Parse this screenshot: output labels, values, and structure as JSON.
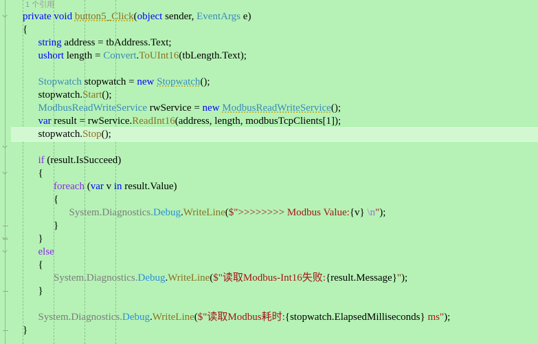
{
  "editor": {
    "language": "csharp",
    "background_color": "#b6f2b6",
    "current_line_color": "#d2f8d2",
    "current_line_index": 9,
    "font_size_px": 15,
    "line_height_px": 19,
    "colors": {
      "keyword": "#0000ff",
      "control_keyword": "#8a2be2",
      "type": "#3b8bb5",
      "method": "#8b7020",
      "string": "#a31515",
      "escape": "#9d74d0",
      "namespace": "#7c7c7c",
      "class_static": "#2e8fd4",
      "plain": "#000000",
      "indent_guide": "#8fbf8f",
      "fold_margin": "#9ab89a"
    }
  },
  "codelens": {
    "text": "1 个引用"
  },
  "code": {
    "lines": [
      {
        "indent": 0,
        "tokens": [
          {
            "t": "private",
            "c": "kw"
          },
          {
            "t": " ",
            "c": "pln"
          },
          {
            "t": "void",
            "c": "kw"
          },
          {
            "t": " ",
            "c": "pln"
          },
          {
            "t": "button5_Click",
            "c": "mth squig"
          },
          {
            "t": "(",
            "c": "pln"
          },
          {
            "t": "object",
            "c": "kw"
          },
          {
            "t": " sender, ",
            "c": "pln"
          },
          {
            "t": "EventArgs",
            "c": "typ"
          },
          {
            "t": " e)",
            "c": "pln"
          }
        ]
      },
      {
        "indent": 0,
        "tokens": [
          {
            "t": "{",
            "c": "pln"
          }
        ]
      },
      {
        "indent": 1,
        "tokens": [
          {
            "t": "string",
            "c": "kw"
          },
          {
            "t": " address = tbAddress.Text;",
            "c": "pln"
          }
        ]
      },
      {
        "indent": 1,
        "tokens": [
          {
            "t": "ushort",
            "c": "kw"
          },
          {
            "t": " length = ",
            "c": "pln"
          },
          {
            "t": "Convert",
            "c": "typ"
          },
          {
            "t": ".",
            "c": "pln"
          },
          {
            "t": "ToUInt16",
            "c": "mth"
          },
          {
            "t": "(tbLength.Text);",
            "c": "pln"
          }
        ]
      },
      {
        "indent": 1,
        "tokens": []
      },
      {
        "indent": 1,
        "tokens": [
          {
            "t": "Stopwatch",
            "c": "typ"
          },
          {
            "t": " stopwatch = ",
            "c": "pln"
          },
          {
            "t": "new",
            "c": "kw"
          },
          {
            "t": " ",
            "c": "pln"
          },
          {
            "t": "Stopwatch",
            "c": "typ squig"
          },
          {
            "t": "();",
            "c": "pln"
          }
        ]
      },
      {
        "indent": 1,
        "tokens": [
          {
            "t": "stopwatch.",
            "c": "pln"
          },
          {
            "t": "Start",
            "c": "mth"
          },
          {
            "t": "();",
            "c": "pln"
          }
        ]
      },
      {
        "indent": 1,
        "tokens": [
          {
            "t": "ModbusReadWriteService",
            "c": "typ"
          },
          {
            "t": " rwService = ",
            "c": "pln"
          },
          {
            "t": "new",
            "c": "kw"
          },
          {
            "t": " ",
            "c": "pln"
          },
          {
            "t": "ModbusReadWriteService",
            "c": "typ squig"
          },
          {
            "t": "();",
            "c": "pln"
          }
        ]
      },
      {
        "indent": 1,
        "tokens": [
          {
            "t": "var",
            "c": "kw"
          },
          {
            "t": " result = rwService.",
            "c": "pln"
          },
          {
            "t": "ReadInt16",
            "c": "mth"
          },
          {
            "t": "(address, length, modbusTcpClients[1]);",
            "c": "pln"
          }
        ]
      },
      {
        "indent": 1,
        "tokens": [
          {
            "t": "stopwatch.",
            "c": "pln"
          },
          {
            "t": "Stop",
            "c": "mth"
          },
          {
            "t": "();",
            "c": "pln"
          }
        ]
      },
      {
        "indent": 1,
        "tokens": []
      },
      {
        "indent": 1,
        "tokens": [
          {
            "t": "if",
            "c": "ctl"
          },
          {
            "t": " (result.IsSucceed)",
            "c": "pln"
          }
        ]
      },
      {
        "indent": 1,
        "tokens": [
          {
            "t": "{",
            "c": "pln"
          }
        ]
      },
      {
        "indent": 2,
        "tokens": [
          {
            "t": "foreach",
            "c": "ctl"
          },
          {
            "t": " (",
            "c": "pln"
          },
          {
            "t": "var",
            "c": "kw"
          },
          {
            "t": " v ",
            "c": "pln"
          },
          {
            "t": "in",
            "c": "kw"
          },
          {
            "t": " result.Value)",
            "c": "pln"
          }
        ]
      },
      {
        "indent": 2,
        "tokens": [
          {
            "t": "{",
            "c": "pln"
          }
        ]
      },
      {
        "indent": 3,
        "tokens": [
          {
            "t": "System.Diagnostics.",
            "c": "cls"
          },
          {
            "t": "Debug",
            "c": "blu"
          },
          {
            "t": ".",
            "c": "pln"
          },
          {
            "t": "WriteLine",
            "c": "mth"
          },
          {
            "t": "(",
            "c": "pln"
          },
          {
            "t": "$\"",
            "c": "str"
          },
          {
            "t": ">>>>>>>> Modbus Value:",
            "c": "str"
          },
          {
            "t": "{v}",
            "c": "pln"
          },
          {
            "t": " ",
            "c": "str"
          },
          {
            "t": "\\n",
            "c": "esc"
          },
          {
            "t": "\"",
            "c": "str"
          },
          {
            "t": ");",
            "c": "pln"
          }
        ]
      },
      {
        "indent": 2,
        "tokens": [
          {
            "t": "}",
            "c": "pln"
          }
        ]
      },
      {
        "indent": 1,
        "tokens": [
          {
            "t": "}",
            "c": "pln"
          }
        ]
      },
      {
        "indent": 1,
        "tokens": [
          {
            "t": "else",
            "c": "ctl"
          }
        ]
      },
      {
        "indent": 1,
        "tokens": [
          {
            "t": "{",
            "c": "pln"
          }
        ]
      },
      {
        "indent": 2,
        "tokens": [
          {
            "t": "System.Diagnostics.",
            "c": "cls"
          },
          {
            "t": "Debug",
            "c": "blu"
          },
          {
            "t": ".",
            "c": "pln"
          },
          {
            "t": "WriteLine",
            "c": "mth"
          },
          {
            "t": "(",
            "c": "pln"
          },
          {
            "t": "$\"",
            "c": "str"
          },
          {
            "t": "读取Modbus-Int16失败:",
            "c": "str"
          },
          {
            "t": "{result.Message}",
            "c": "pln"
          },
          {
            "t": "\"",
            "c": "str"
          },
          {
            "t": ");",
            "c": "pln"
          }
        ]
      },
      {
        "indent": 1,
        "tokens": [
          {
            "t": "}",
            "c": "pln"
          }
        ]
      },
      {
        "indent": 1,
        "tokens": []
      },
      {
        "indent": 1,
        "tokens": [
          {
            "t": "System.Diagnostics.",
            "c": "cls"
          },
          {
            "t": "Debug",
            "c": "blu"
          },
          {
            "t": ".",
            "c": "pln"
          },
          {
            "t": "WriteLine",
            "c": "mth"
          },
          {
            "t": "(",
            "c": "pln"
          },
          {
            "t": "$\"",
            "c": "str"
          },
          {
            "t": "读取Modbus耗时:",
            "c": "str"
          },
          {
            "t": "{stopwatch.ElapsedMilliseconds}",
            "c": "pln"
          },
          {
            "t": " ms",
            "c": "str"
          },
          {
            "t": "\"",
            "c": "str"
          },
          {
            "t": ");",
            "c": "pln"
          }
        ]
      },
      {
        "indent": 0,
        "tokens": [
          {
            "t": "}",
            "c": "pln"
          }
        ]
      }
    ]
  },
  "fold_margin": {
    "chevron_line_indices": [
      0,
      10,
      12,
      17,
      18
    ],
    "segment_line_indices": [
      16,
      17,
      21,
      24
    ]
  },
  "indent_guides": {
    "x_positions": [
      33,
      78,
      123,
      168
    ]
  }
}
